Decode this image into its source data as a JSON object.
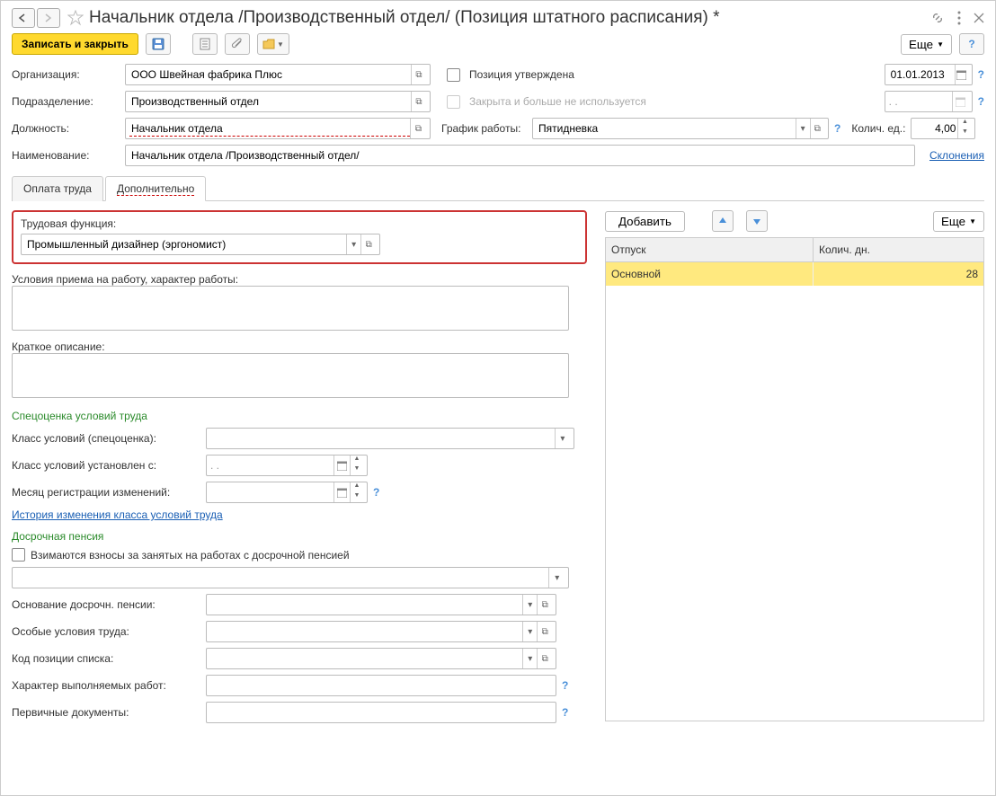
{
  "title": "Начальник отдела /Производственный отдел/ (Позиция штатного расписания) *",
  "toolbar": {
    "save_close": "Записать и закрыть",
    "more": "Еще"
  },
  "fields": {
    "org_label": "Организация:",
    "org_value": "ООО Швейная фабрика Плюс",
    "approved_label": "Позиция утверждена",
    "date_value": "01.01.2013",
    "dept_label": "Подразделение:",
    "dept_value": "Производственный отдел",
    "closed_label": "Закрыта и больше не используется",
    "date_empty": ". .",
    "position_label": "Должность:",
    "position_value": "Начальник отдела",
    "schedule_label": "График работы:",
    "schedule_value": "Пятидневка",
    "qty_label": "Колич. ед.:",
    "qty_value": "4,00",
    "name_label": "Наименование:",
    "name_value": "Начальник отдела /Производственный отдел/",
    "declensions": "Склонения"
  },
  "tabs": {
    "pay": "Оплата труда",
    "extra": "Дополнительно"
  },
  "left": {
    "labor_func_label": "Трудовая функция:",
    "labor_func_value": "Промышленный дизайнер (эргономист)",
    "hire_cond": "Условия приема на работу, характер работы:",
    "short_desc": "Краткое описание:",
    "spec_title": "Спецоценка условий труда",
    "class_label": "Класс условий (спецоценка):",
    "class_date_label": "Класс условий установлен с:",
    "month_reg_label": "Месяц регистрации изменений:",
    "history_link": "История изменения класса условий труда",
    "pension_title": "Досрочная пенсия",
    "pension_check": "Взимаются взносы за занятых на работах с досрочной пенсией",
    "pension_basis": "Основание досрочн. пенсии:",
    "special_cond": "Особые условия труда:",
    "list_code": "Код позиции списка:",
    "work_nature": "Характер выполняемых работ:",
    "primary_docs": "Первичные документы:"
  },
  "right": {
    "add": "Добавить",
    "more": "Еще",
    "col1": "Отпуск",
    "col2": "Колич. дн.",
    "row1_name": "Основной",
    "row1_days": "28"
  }
}
